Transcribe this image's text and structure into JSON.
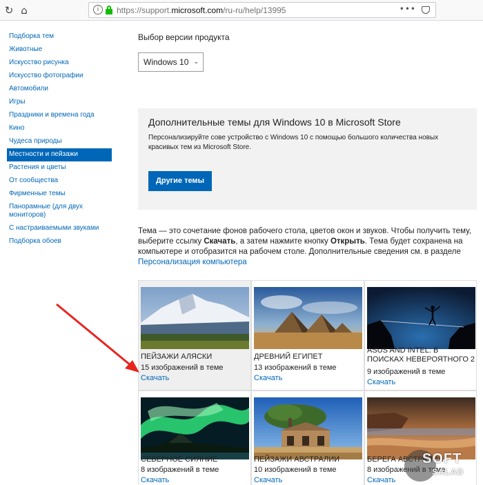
{
  "browser": {
    "url_prefix": "https://support.",
    "url_domain": "microsoft.com",
    "url_path": "/ru-ru/help/13995",
    "menu_dots": "•••"
  },
  "sidebar": {
    "items": [
      {
        "label": "Подборка тем"
      },
      {
        "label": "Животные"
      },
      {
        "label": "Искусство рисунка"
      },
      {
        "label": "Искусство фотографии"
      },
      {
        "label": "Автомобили"
      },
      {
        "label": "Игры"
      },
      {
        "label": "Праздники и времена года"
      },
      {
        "label": "Кино"
      },
      {
        "label": "Чудеса природы"
      },
      {
        "label": "Местности и пейзажи"
      },
      {
        "label": "Растения и цветы"
      },
      {
        "label": "От сообщества"
      },
      {
        "label": "Фирменные темы"
      },
      {
        "label": "Панорамные (для двух мониторов)"
      },
      {
        "label": "С настраиваемыми звуками"
      },
      {
        "label": "Подборка обоев"
      }
    ],
    "active_index": 9
  },
  "product": {
    "label": "Выбор версии продукта",
    "selected": "Windows 10"
  },
  "promo": {
    "title": "Дополнительные темы для Windows 10 в Microsoft Store",
    "text": "Персонализируйте сове устройство с Windows 10 с помощью большого количества новых красивых тем из Microsoft Store.",
    "button": "Другие темы"
  },
  "description": {
    "part1": "Тема — это сочетание фонов рабочего стола, цветов окон и звуков. Чтобы получить тему, выберите ссылку ",
    "download_word": "Скачать",
    "part2": ", а затем нажмите кнопку ",
    "open_word": "Открыть",
    "part3": ". Тема будет сохранена на компьютере и отобразится на рабочем столе. Дополнительные сведения см. в разделе ",
    "link": "Персонализация компьютера"
  },
  "themes": [
    {
      "title": "Пейзажи Аляски",
      "count": "15 изображений в теме",
      "link": "Скачать",
      "thumb": "mountain"
    },
    {
      "title": "Древний Египет",
      "count": "13 изображений в теме",
      "link": "Скачать",
      "thumb": "pyramids"
    },
    {
      "title": "ASUS and Intel: В поисках невероятного 2",
      "count": "9 изображений в теме",
      "link": "Скачать",
      "thumb": "slackline"
    },
    {
      "title": "Северное сияние",
      "count": "8 изображений в теме",
      "link": "Скачать",
      "thumb": "aurora"
    },
    {
      "title": "Пейзажи Австралии",
      "count": "10 изображений в теме",
      "link": "Скачать",
      "thumb": "ruins"
    },
    {
      "title": "Берега Австралии",
      "count": "8 изображений в теме",
      "link": "Скачать",
      "thumb": "beach"
    }
  ],
  "watermark": {
    "soft": "SOFT",
    "salad": "SALAD"
  },
  "colors": {
    "link": "#0067b8",
    "accent_button": "#0067b8",
    "arrow": "#e8241e",
    "promo_bg": "#f2f2f2"
  }
}
